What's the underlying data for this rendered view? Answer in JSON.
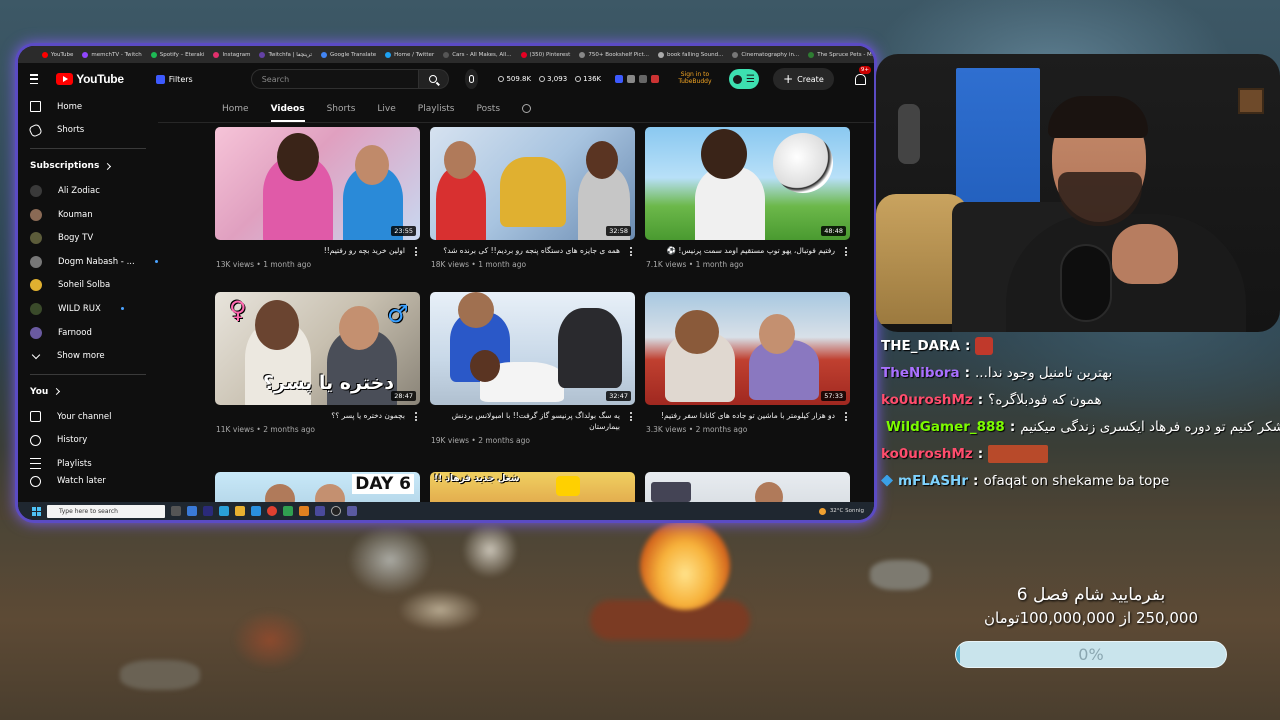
{
  "browser": {
    "bookmarks": [
      "YouTube",
      "memchTV - Twitch",
      "Spotify – Eteraki",
      "Instagram",
      "Twitchfa | ترینچفا",
      "Google Translate",
      "Home / Twitter",
      "Cars - All Makes, All...",
      "(350) Pinterest",
      "750+ Bookshelf Pict...",
      "book falling Sound...",
      "Cinematography in...",
      "The Spruce Pets - M..."
    ]
  },
  "youtube": {
    "logo_text": "YouTube",
    "filters_label": "Filters",
    "search_placeholder": "Search",
    "stats": {
      "views": "509.8K",
      "subs": "3,093",
      "watch": "136K"
    },
    "tubebuddy_label": "Sign in to TubeBuddy",
    "create_label": "Create",
    "notif_badge": "9+",
    "sidebar": {
      "home": "Home",
      "shorts": "Shorts",
      "subscriptions_heading": "Subscriptions",
      "subscriptions": [
        {
          "name": "Ali Zodiac",
          "color": "#3a3a3a",
          "live": false
        },
        {
          "name": "Kouman",
          "color": "#8a6a55",
          "live": false
        },
        {
          "name": "Bogy TV",
          "color": "#5c5c3a",
          "live": false
        },
        {
          "name": "Dogm Nabash - ...",
          "color": "#777777",
          "live": true
        },
        {
          "name": "Soheil Solba",
          "color": "#e0b030",
          "live": false
        },
        {
          "name": "WILD RUX",
          "color": "#3a4a2a",
          "live": true
        },
        {
          "name": "Farnood",
          "color": "#6a5aa0",
          "live": false
        }
      ],
      "show_more": "Show more",
      "you_heading": "You",
      "you_items": [
        "Your channel",
        "History",
        "Playlists",
        "Watch later"
      ]
    },
    "tabs": [
      "Home",
      "Videos",
      "Shorts",
      "Live",
      "Playlists",
      "Posts"
    ],
    "active_tab": "Videos",
    "videos": [
      {
        "title": "اولین خرید بچه رو رفتیم!!",
        "meta": "13K views • 1 month ago",
        "duration": "23:55"
      },
      {
        "title": "همه ی جایزه های دستگاه پنجه رو بردیم!! کی برنده شد؟",
        "meta": "18K views • 1 month ago",
        "duration": "32:58"
      },
      {
        "title": "رفتیم فوتبال، یهو توپ مستقیم اومد سمت پرنیس! ⚽",
        "meta": "7.1K views • 1 month ago",
        "duration": "48:48"
      },
      {
        "title": "بچمون دختره یا پسر ؟؟",
        "meta": "11K views • 2 months ago",
        "duration": "28:47",
        "overlay": "دختره یا پسر؟"
      },
      {
        "title": "یه سگ بولداگ پرنیسو گاز گرفت!! با امبولانس بردنش بیمارستان",
        "meta": "19K views • 2 months ago",
        "duration": "32:47"
      },
      {
        "title": "دو هزار کیلومتر با ماشین تو جاده های کانادا سفر رفتیم!",
        "meta": "3.3K views • 2 months ago",
        "duration": "57:33"
      }
    ],
    "next_row_overlays": [
      "DAY 6",
      "شغل جدید فرهاد !!"
    ]
  },
  "taskbar": {
    "search_placeholder": "Type here to search",
    "weather": "32°C  Sonnig"
  },
  "chat": [
    {
      "user": "THE_DARA",
      "user_color": "#ffffff",
      "msg": "",
      "emote_color": "#c0392b"
    },
    {
      "user": "TheNibora",
      "user_color": "#a970ff",
      "msg": "بهترین تامنیل وجود ندا...",
      "emote_color": ""
    },
    {
      "user": "ko0uroshMz",
      "user_color": "#ff4d6d",
      "msg": "همون که فودبلاگره؟",
      "emote_color": ""
    },
    {
      "user": "WildGamer_888",
      "user_color": "#7cfc00",
      "msg": "رو باید شکر کنیم تو دوره فرهاد ایکسری زندگی میکنیم",
      "emote_color": "",
      "badge": "#2ecc71"
    },
    {
      "user": "ko0uroshMz",
      "user_color": "#ff4d6d",
      "msg": "",
      "emote_wide": "#b84a2a"
    },
    {
      "user": "mFLASHr",
      "user_color": "#7fd3ff",
      "msg": "ofaqat on shekame ba tope",
      "emote_color": "",
      "badge": "#3aa0e8"
    }
  ],
  "goal": {
    "title": "بفرمایید شام فصل 6",
    "amount": "250,000 از 100,000,000تومان",
    "percent_label": "0%",
    "percent": 0
  }
}
